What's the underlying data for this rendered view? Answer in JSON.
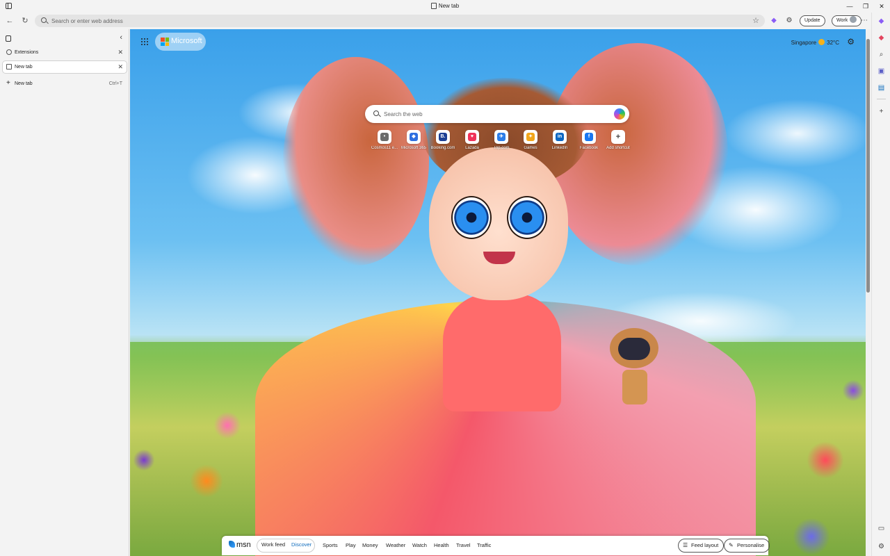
{
  "window": {
    "title": "New tab"
  },
  "toolbar": {
    "address_placeholder": "Search or enter web address",
    "update_label": "Update",
    "profile_label": "Work"
  },
  "vertical_tabs": {
    "items": [
      {
        "label": "Extensions"
      },
      {
        "label": "New tab"
      }
    ],
    "new_tab_label": "New tab",
    "new_tab_shortcut": "Ctrl+T"
  },
  "ntp": {
    "brand": "Microsoft",
    "weather": {
      "city": "Singapore",
      "temp": "32°C"
    },
    "search_placeholder": "Search the web",
    "quick_links": [
      {
        "label": "Cosmos11 e...",
        "color": "#6b6b6b",
        "glyph": "•"
      },
      {
        "label": "Microsoft 365",
        "color": "#2f6fe0",
        "glyph": "◆"
      },
      {
        "label": "Booking.com",
        "color": "#1c3f94",
        "glyph": "B."
      },
      {
        "label": "Lazada",
        "color": "#f0335a",
        "glyph": "♥"
      },
      {
        "label": "Trip.com",
        "color": "#2b7de9",
        "glyph": "✈"
      },
      {
        "label": "Games",
        "color": "#f2a61b",
        "glyph": "✦"
      },
      {
        "label": "LinkedIn",
        "color": "#0a66c2",
        "glyph": "in"
      },
      {
        "label": "Facebook",
        "color": "#1877f2",
        "glyph": "f"
      },
      {
        "label": "Add shortcut",
        "color": "#ffffff",
        "glyph": "+"
      }
    ]
  },
  "feed_bar": {
    "logo": "msn",
    "work_feed": "Work feed",
    "discover": "Discover",
    "tabs": [
      "Sports",
      "Play",
      "Money",
      "Weather",
      "Watch",
      "Health",
      "Travel",
      "Traffic"
    ],
    "feed_layout": "Feed layout",
    "personalise": "Personalise"
  },
  "colors": {
    "accent": "#0f6cbd",
    "sidebar_bg": "#f3f3f3"
  }
}
